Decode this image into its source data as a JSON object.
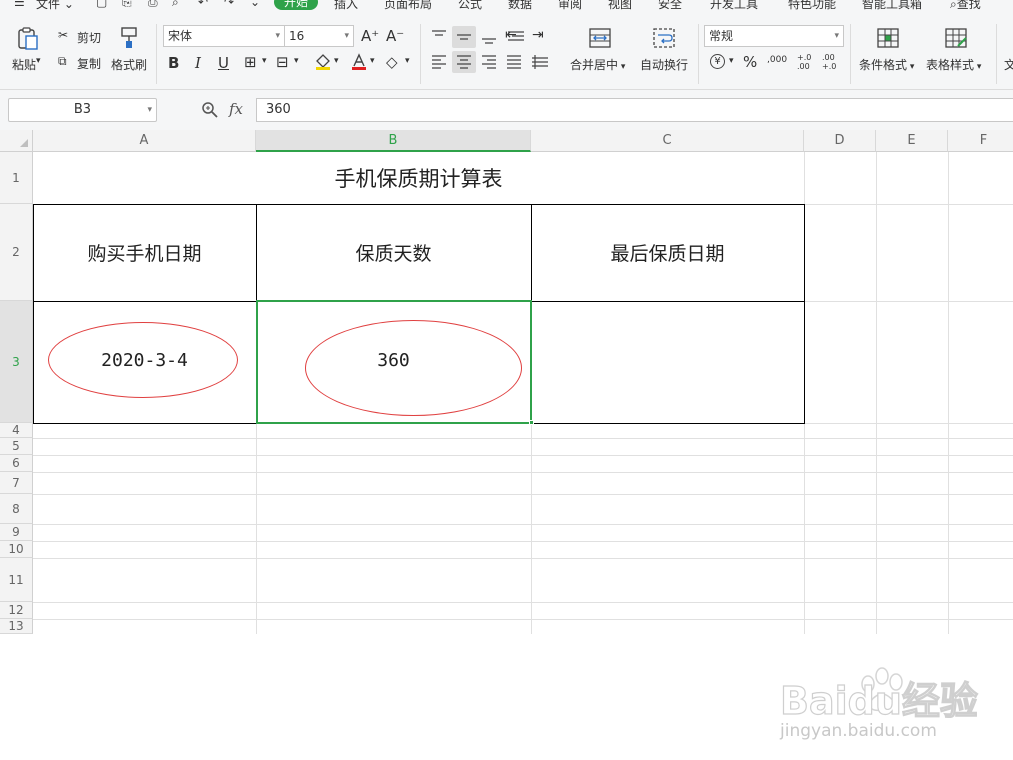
{
  "menu": {
    "items": [
      "文件",
      "开始",
      "插入",
      "页面布局",
      "公式",
      "数据",
      "审阅",
      "视图",
      "安全",
      "开发工具",
      "特色功能",
      "智能工具箱",
      "查找"
    ]
  },
  "ribbon": {
    "paste_label": "粘贴",
    "cut_label": "剪切",
    "copy_label": "复制",
    "format_painter_label": "格式刷",
    "font_name": "宋体",
    "font_size": "16",
    "merge_center_label": "合并居中",
    "wrap_text_label": "自动换行",
    "number_format": "常规",
    "conditional_format_label": "条件格式",
    "table_style_label": "表格样式",
    "bold_glyph": "B",
    "italic_glyph": "I",
    "underline_glyph": "U",
    "currency_glyph": "¥",
    "percent_glyph": "%",
    "thousands_glyph": ",000",
    "inc_decimal_glyph": "+.0 .00",
    "dec_decimal_glyph": ".00 +.0",
    "font_grow_glyph": "A⁺",
    "font_shrink_glyph": "A⁻",
    "text_partial": "文"
  },
  "formula_bar": {
    "name_box": "B3",
    "fx_label": "fx",
    "value": "360"
  },
  "sheet": {
    "columns": [
      "A",
      "B",
      "C",
      "D",
      "E",
      "F"
    ],
    "rows": [
      "1",
      "2",
      "3",
      "4",
      "5",
      "6",
      "7",
      "8",
      "9",
      "10",
      "11",
      "12",
      "13"
    ],
    "title": "手机保质期计算表",
    "header_purchase_date": "购买手机日期",
    "header_warranty_days": "保质天数",
    "header_final_date": "最后保质日期",
    "purchase_date": "2020-3-4",
    "warranty_days": "360",
    "final_date": "",
    "selected_column": "B",
    "selected_row": "3"
  },
  "watermark": {
    "text": "Baidu经验",
    "url": "jingyan.baidu.com"
  },
  "colors": {
    "accent": "#2fa24a",
    "annotation": "#e04040"
  }
}
